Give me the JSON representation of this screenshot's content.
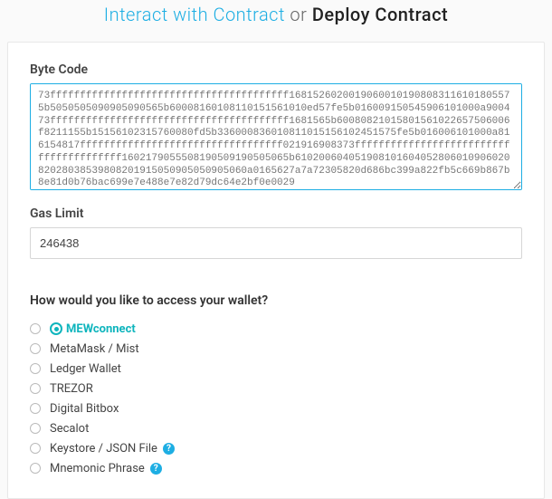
{
  "header": {
    "interact_link": "Interact with Contract",
    "or_text": "or",
    "deploy_text": "Deploy Contract"
  },
  "form": {
    "bytecode_label": "Byte Code",
    "bytecode_value": "73ffffffffffffffffffffffffffffffffffffffff16815260200190600101908083116101805575b5050505090905090565b60008160108110151561010ed57fe5b016009150545906101000a900473ffffffffffffffffffffffffffffffffffffffff1681565b60080821015801561022657506006f8211155b15156102315760080fd5b336000836010811015156102451575fe5b016006101000a816154817ffffffffffffffffffffffffffffffffff021916908373ffffffffffffffffffffffffffffffffffffffff1602179055508190509190505065b61020060405190810160405280601090602082028038539808201915050905050905060a0165627a7a72305820d686bc399a822fb5c669b867b8e81d0b76bac699e7e488e7e82d79dc64e2bf0e0029",
    "gas_label": "Gas Limit",
    "gas_value": "246438"
  },
  "wallet": {
    "question": "How would you like to access your wallet?",
    "options": [
      {
        "label": "MEWconnect",
        "mew": true,
        "help": false
      },
      {
        "label": "MetaMask / Mist",
        "mew": false,
        "help": false
      },
      {
        "label": "Ledger Wallet",
        "mew": false,
        "help": false
      },
      {
        "label": "TREZOR",
        "mew": false,
        "help": false
      },
      {
        "label": "Digital Bitbox",
        "mew": false,
        "help": false
      },
      {
        "label": "Secalot",
        "mew": false,
        "help": false
      },
      {
        "label": "Keystore / JSON File",
        "mew": false,
        "help": true
      },
      {
        "label": "Mnemonic Phrase",
        "mew": false,
        "help": true
      }
    ]
  }
}
